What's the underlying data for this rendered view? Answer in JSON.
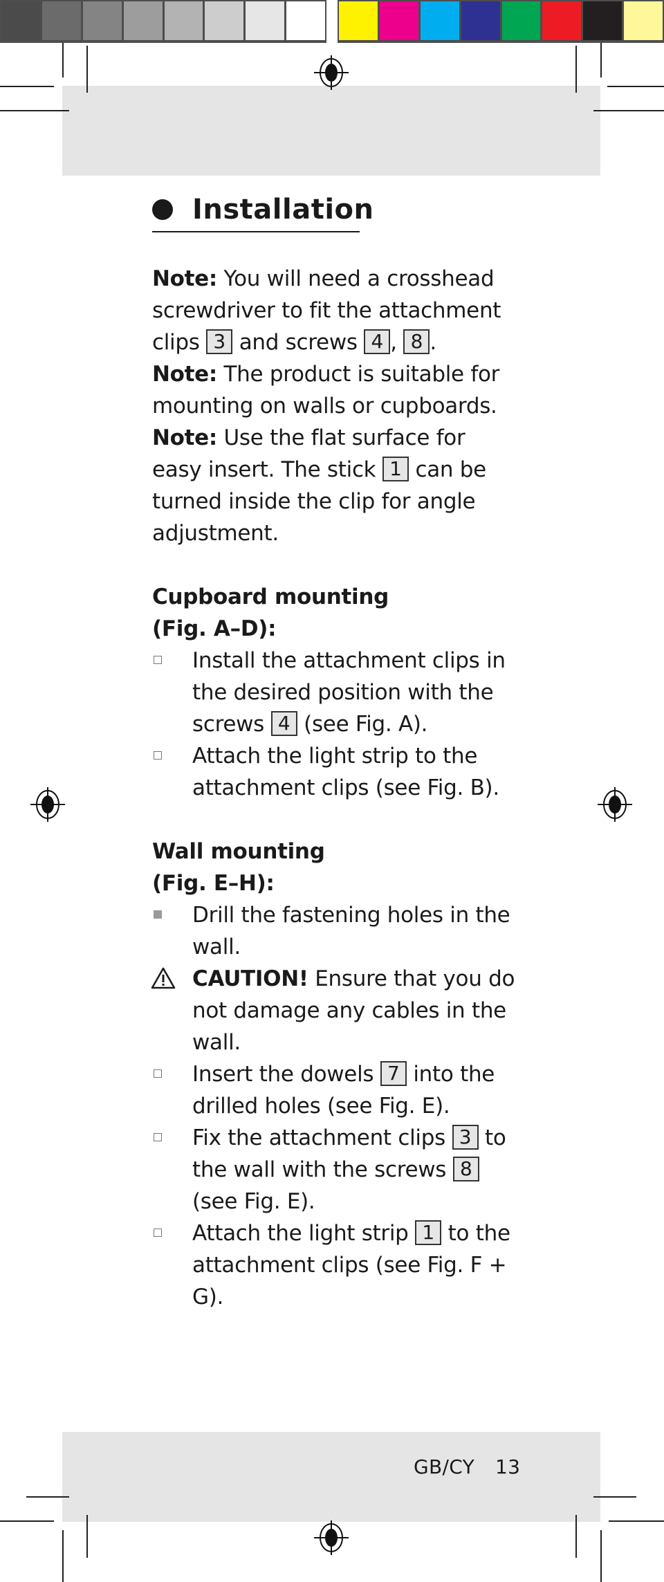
{
  "print_marks": {
    "gray_swatches": [
      "#4b4b4b",
      "#6b6b6b",
      "#848484",
      "#9d9d9d",
      "#b3b3b3",
      "#cdcdcd",
      "#e6e6e6",
      "#ffffff"
    ],
    "color_swatches": [
      "#fff200",
      "#ec008c",
      "#00aeef",
      "#2e3192",
      "#00a651",
      "#ed1c24",
      "#231f20",
      "#fff799"
    ]
  },
  "section": {
    "title": "Installation",
    "notes": [
      {
        "label": "Note:",
        "parts": [
          "You will need a crosshead screwdriver to fit the attachment clips ",
          "3",
          " and screws ",
          "4",
          ", ",
          "8",
          "."
        ]
      },
      {
        "label": "Note:",
        "text": "The product is suitable for mounting on walls or cupboards."
      },
      {
        "label": "Note:",
        "parts": [
          "Use the flat surface for easy insert. The stick ",
          "1",
          " can be turned inside the clip for angle adjustment."
        ]
      }
    ],
    "cupboard": {
      "heading_line1": "Cupboard mounting",
      "heading_line2": "(Fig. A–D):",
      "steps": [
        {
          "bullet": "checkbox",
          "parts": [
            "Install the attachment clips in the desired position with the screws ",
            "4",
            " (see Fig. A)."
          ]
        },
        {
          "bullet": "checkbox",
          "text": "Attach the light strip to the attachment clips (see Fig. B)."
        }
      ]
    },
    "wall": {
      "heading_line1": "Wall mounting",
      "heading_line2": "(Fig. E–H):",
      "steps": [
        {
          "bullet": "filled-square",
          "text": "Drill the fastening holes in the wall."
        },
        {
          "bullet": "warning",
          "label": "CAUTION!",
          "text": "Ensure that you do not damage any cables in the wall."
        },
        {
          "bullet": "checkbox",
          "parts": [
            "Insert the dowels ",
            "7",
            " into the drilled holes (see Fig. E)."
          ]
        },
        {
          "bullet": "checkbox",
          "parts": [
            "Fix the attachment clips ",
            "3",
            " to the wall with the screws ",
            "8",
            " (see Fig. E)."
          ]
        },
        {
          "bullet": "checkbox",
          "parts": [
            "Attach the light strip ",
            "1",
            " to the attachment clips (see Fig. F + G)."
          ]
        }
      ]
    }
  },
  "footer": {
    "region": "GB/CY",
    "page": "13"
  }
}
